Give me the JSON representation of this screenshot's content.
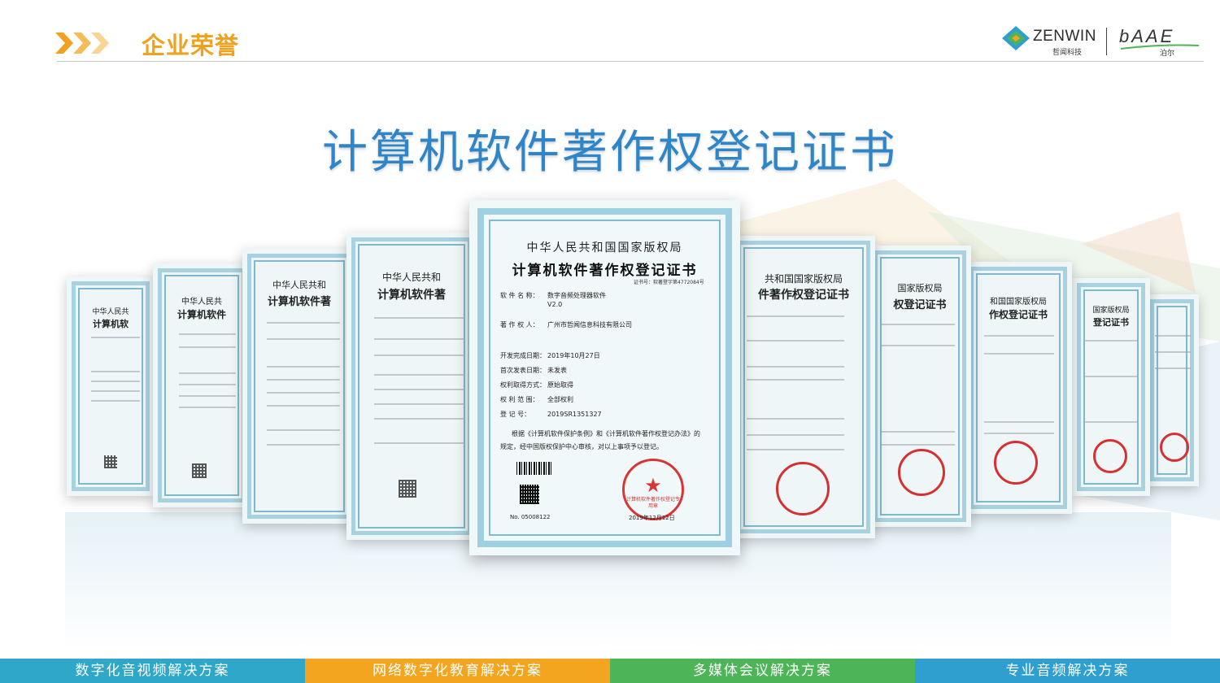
{
  "header": {
    "section_title": "企业荣誉",
    "logo_zenwin": "ZENWIN",
    "logo_zenwin_sub": "哲闻科技",
    "logo_baae": "bAAE",
    "logo_baae_sub": "泊尔"
  },
  "main_title": "计算机软件著作权登记证书",
  "colors": {
    "accent_orange": "#f0a21e",
    "title_blue": "#2e86c8",
    "bar1": "#2ea7c9",
    "bar2": "#f3a51f",
    "bar3": "#4db457",
    "bar4": "#2e9fcf",
    "seal_red": "#d83535"
  },
  "certificate": {
    "authority": "中华人民共和国国家版权局",
    "title": "计算机软件著作权登记证书",
    "cert_no": "证书号：软著登字第4772084号",
    "fields": [
      {
        "key": "软 件 名 称：",
        "value": "数字音频处理器软件"
      },
      {
        "key": "",
        "value": "V2.0"
      },
      {
        "key": "著 作 权 人：",
        "value": "广州市哲闻信息科技有限公司"
      },
      {
        "key": "开发完成日期：",
        "value": "2019年10月27日"
      },
      {
        "key": "首次发表日期：",
        "value": "未发表"
      },
      {
        "key": "权利取得方式：",
        "value": "原始取得"
      },
      {
        "key": "权 利 范 围：",
        "value": "全部权利"
      },
      {
        "key": "登   记   号：",
        "value": "2019SR1351327"
      }
    ],
    "notice_1": "根据《计算机软件保护条例》和《计算机软件著作权登记办法》的",
    "notice_2": "规定，经中国版权保护中心审核，对以上事项予以登记。",
    "serial": "No. 05008122",
    "seal_text": "计算机软件著作权登记专用章",
    "date": "2019年12月12日"
  },
  "side_certs": {
    "c1_t1": "中华人民共",
    "c1_t2": "计算机软",
    "c2_t1": "中华人民共",
    "c2_t2": "计算机软件",
    "c3_t1": "中华人民共和",
    "c3_t2": "计算机软件著",
    "c4_t1": "中华人民共和",
    "c4_t2": "计算机软件著",
    "r1_t1": "共和国国家版权局",
    "r1_t2": "件著作权登记证书",
    "r2_t1": "国家版权局",
    "r2_t2": "权登记证书",
    "r3_t1": "和国国家版权局",
    "r3_t2": "作权登记证书",
    "r4_t1": "国家版权局",
    "r4_t2": "登记证书"
  },
  "bottom_bar": [
    "数字化音视频解决方案",
    "网络数字化教育解决方案",
    "多媒体会议解决方案",
    "专业音频解决方案"
  ]
}
